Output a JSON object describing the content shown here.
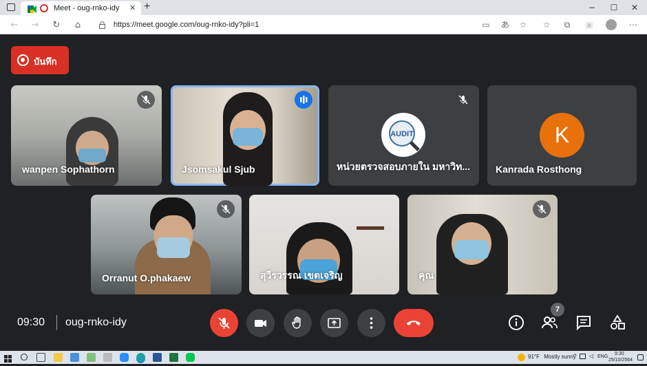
{
  "browser": {
    "tab_title": "Meet - oug-rnko-idy",
    "new_tab": "+",
    "url": "https://meet.google.com/oug-rnko-idy?pli=1",
    "window_controls": {
      "minimize": "−",
      "maximize": "☐",
      "close": "✕"
    }
  },
  "meet": {
    "record_label": "บันทึก",
    "time": "09:30",
    "meeting_code": "oug-rnko-idy",
    "people_count": "7",
    "tiles": [
      {
        "name": "wanpen Sophathorn",
        "muted": true
      },
      {
        "name": "Jsomsakul Sjub",
        "muted": false,
        "speaking": true
      },
      {
        "name": "หน่วยตรวจสอบภายใน มหาวิท...",
        "muted": true,
        "avatar": "audit-logo"
      },
      {
        "name": "Kanrada Rosthong",
        "muted": false,
        "avatar_letter": "K",
        "avatar_color": "#e8710a"
      },
      {
        "name": "Orranut O.phakaew",
        "muted": true
      },
      {
        "name": "สุวีรวรรณ เขตเจริญ",
        "muted": false
      },
      {
        "name": "คุณ",
        "muted": true
      }
    ],
    "colors": {
      "background": "#202124",
      "tile": "#3c4043",
      "red": "#ea4335",
      "accent": "#8ab4f8"
    }
  },
  "taskbar": {
    "weather_temp": "91°F",
    "weather_desc": "Mostly sunny",
    "language": "ENG",
    "clock_time": "9:30",
    "clock_date": "25/10/2564"
  }
}
